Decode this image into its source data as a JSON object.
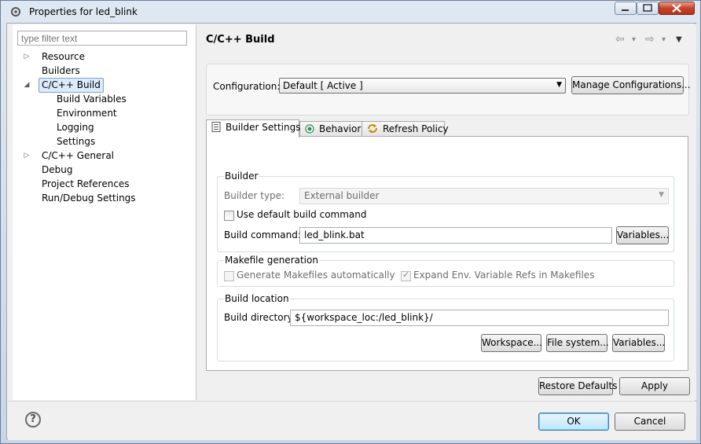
{
  "window": {
    "title": "Properties for led_blink"
  },
  "filter": {
    "placeholder": "type filter text"
  },
  "tree": [
    {
      "label": "Resource",
      "twisty": "▷"
    },
    {
      "label": "Builders",
      "twisty": ""
    },
    {
      "label": "C/C++ Build",
      "twisty": "◢",
      "selected": true
    },
    {
      "label": "Build Variables",
      "twisty": ""
    },
    {
      "label": "Environment",
      "twisty": ""
    },
    {
      "label": "Logging",
      "twisty": ""
    },
    {
      "label": "Settings",
      "twisty": ""
    },
    {
      "label": "C/C++ General",
      "twisty": "▷"
    },
    {
      "label": "Debug",
      "twisty": ""
    },
    {
      "label": "Project References",
      "twisty": ""
    },
    {
      "label": "Run/Debug Settings",
      "twisty": ""
    }
  ],
  "page": {
    "title": "C/C++ Build",
    "nav": {
      "back": "⇦",
      "back_menu": "▾",
      "forward": "⇨",
      "forward_menu": "▾",
      "view_menu": "▼"
    }
  },
  "configuration": {
    "label": "Configuration:",
    "value": "Default  [ Active ]",
    "manage_button": "Manage Configurations..."
  },
  "tabs": [
    {
      "label": "Builder Settings",
      "icon": "document-icon",
      "active": true
    },
    {
      "label": "Behavior",
      "icon": "radio-icon",
      "active": false
    },
    {
      "label": "Refresh Policy",
      "icon": "refresh-icon",
      "active": false
    }
  ],
  "builder": {
    "group_title": "Builder",
    "type_label": "Builder type:",
    "type_value": "External builder",
    "use_default_label": "Use default build command",
    "use_default_checked": false,
    "command_label": "Build command:",
    "command_value": "led_blink.bat",
    "variables_button": "Variables..."
  },
  "makefile": {
    "group_title": "Makefile generation",
    "generate_label": "Generate Makefiles automatically",
    "generate_checked": false,
    "expand_label": "Expand Env. Variable Refs in Makefiles",
    "expand_checked": true
  },
  "location": {
    "group_title": "Build location",
    "dir_label": "Build directory:",
    "dir_value": "${workspace_loc:/led_blink}/",
    "workspace_button": "Workspace...",
    "filesystem_button": "File system...",
    "variables_button": "Variables..."
  },
  "actions": {
    "restore_defaults": "Restore Defaults",
    "apply": "Apply",
    "ok": "OK",
    "cancel": "Cancel",
    "help": "?"
  }
}
